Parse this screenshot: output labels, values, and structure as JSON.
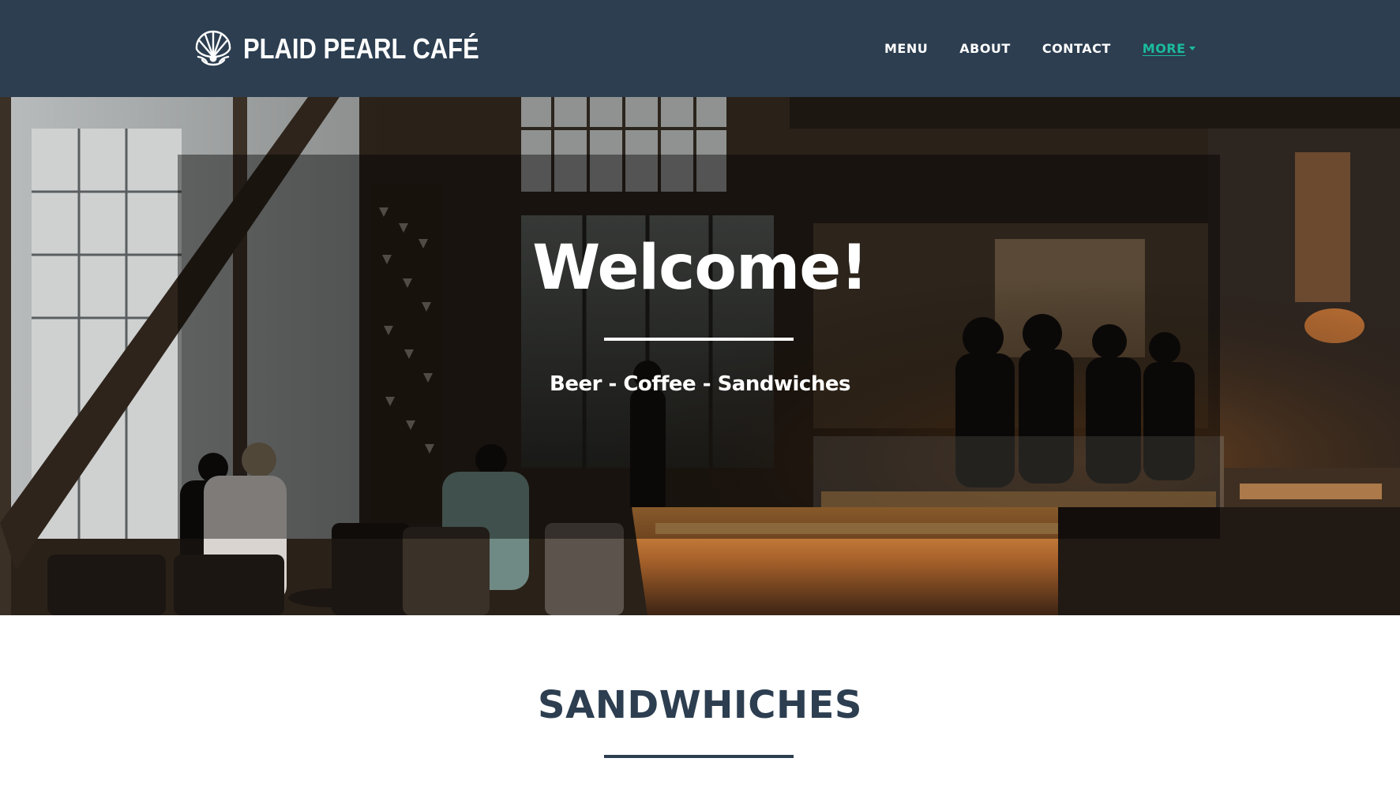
{
  "colors": {
    "navbar_bg": "#2c3e50",
    "accent": "#1abc9c",
    "text_light": "#ffffff",
    "heading_dark": "#2c3e50"
  },
  "navbar": {
    "logo_icon": "pearl-shell-icon",
    "brand": "PLAID PEARL CAFÉ",
    "links": [
      {
        "label": "MENU"
      },
      {
        "label": "ABOUT"
      },
      {
        "label": "CONTACT"
      },
      {
        "label": "MORE",
        "icon": "caret-down-icon",
        "active": true
      }
    ]
  },
  "hero": {
    "title": "Welcome!",
    "subtitle": "Beer - Coffee - Sandwiches"
  },
  "section": {
    "title": "SANDWHICHES"
  }
}
